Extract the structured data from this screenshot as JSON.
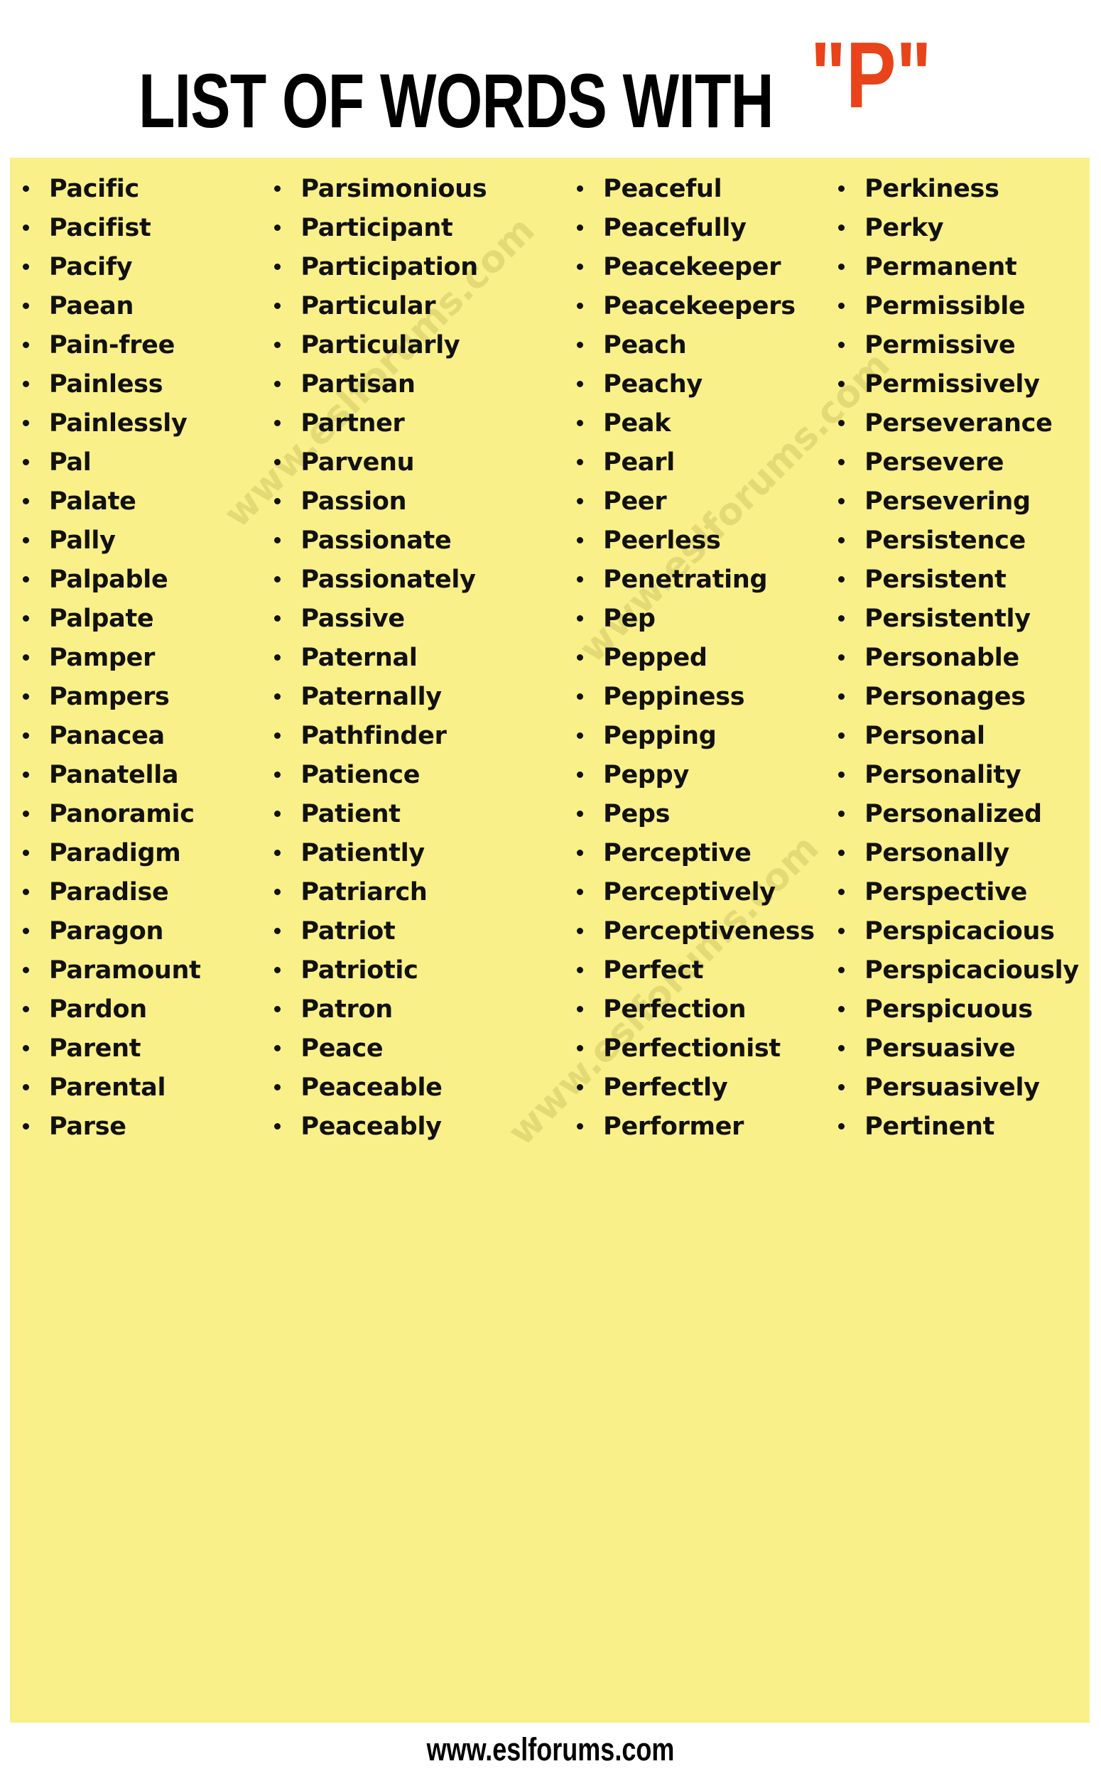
{
  "header": {
    "title_main": "LIST OF WORDS WITH",
    "title_letter": "\"P\"",
    "letter_color": "#e8431a",
    "title_color": "#000000"
  },
  "panel": {
    "background_color": "#faf089"
  },
  "watermark": {
    "text": "www.eslforums.com",
    "instances": [
      "www.eslforums.com",
      "www.eslforums.com",
      "www.eslforums.com"
    ]
  },
  "footer": {
    "text": "www.eslforums.com"
  },
  "word_list": {
    "bullet_glyph": "•",
    "columns": [
      {
        "index": 0,
        "words": [
          "Pacific",
          "Pacifist",
          "Pacify",
          "Paean",
          "Pain-free",
          "Painless",
          "Painlessly",
          "Pal",
          "Palate",
          "Pally",
          "Palpable",
          "Palpate",
          "Pamper",
          "Pampers",
          "Panacea",
          "Panatella",
          "Panoramic",
          "Paradigm",
          "Paradise",
          "Paragon",
          "Paramount",
          "Pardon",
          "Parent",
          "Parental",
          "Parse"
        ]
      },
      {
        "index": 1,
        "words": [
          "Parsimonious",
          "Participant",
          "Participation",
          "Particular",
          "Particularly",
          "Partisan",
          "Partner",
          "Parvenu",
          "Passion",
          "Passionate",
          "Passionately",
          "Passive",
          "Paternal",
          "Paternally",
          "Pathfinder",
          "Patience",
          "Patient",
          "Patiently",
          "Patriarch",
          "Patriot",
          "Patriotic",
          "Patron",
          "Peace",
          "Peaceable",
          "Peaceably"
        ]
      },
      {
        "index": 2,
        "words": [
          "Peaceful",
          "Peacefully",
          "Peacekeeper",
          "Peacekeepers",
          "Peach",
          "Peachy",
          "Peak",
          "Pearl",
          "Peer",
          "Peerless",
          "Penetrating",
          "Pep",
          "Pepped",
          "Peppiness",
          "Pepping",
          "Peppy",
          "Peps",
          "Perceptive",
          "Perceptively",
          "Perceptiveness",
          "Perfect",
          "Perfection",
          "Perfectionist",
          "Perfectly",
          "Performer"
        ]
      },
      {
        "index": 3,
        "words": [
          "Perkiness",
          "Perky",
          "Permanent",
          "Permissible",
          "Permissive",
          "Permissively",
          "Perseverance",
          "Persevere",
          "Persevering",
          "Persistence",
          "Persistent",
          "Persistently",
          "Personable",
          "Personages",
          "Personal",
          "Personality",
          "Personalized",
          "Personally",
          "Perspective",
          "Perspicacious",
          "Perspicaciously",
          "Perspicuous",
          "Persuasive",
          "Persuasively",
          "Pertinent"
        ]
      }
    ]
  }
}
